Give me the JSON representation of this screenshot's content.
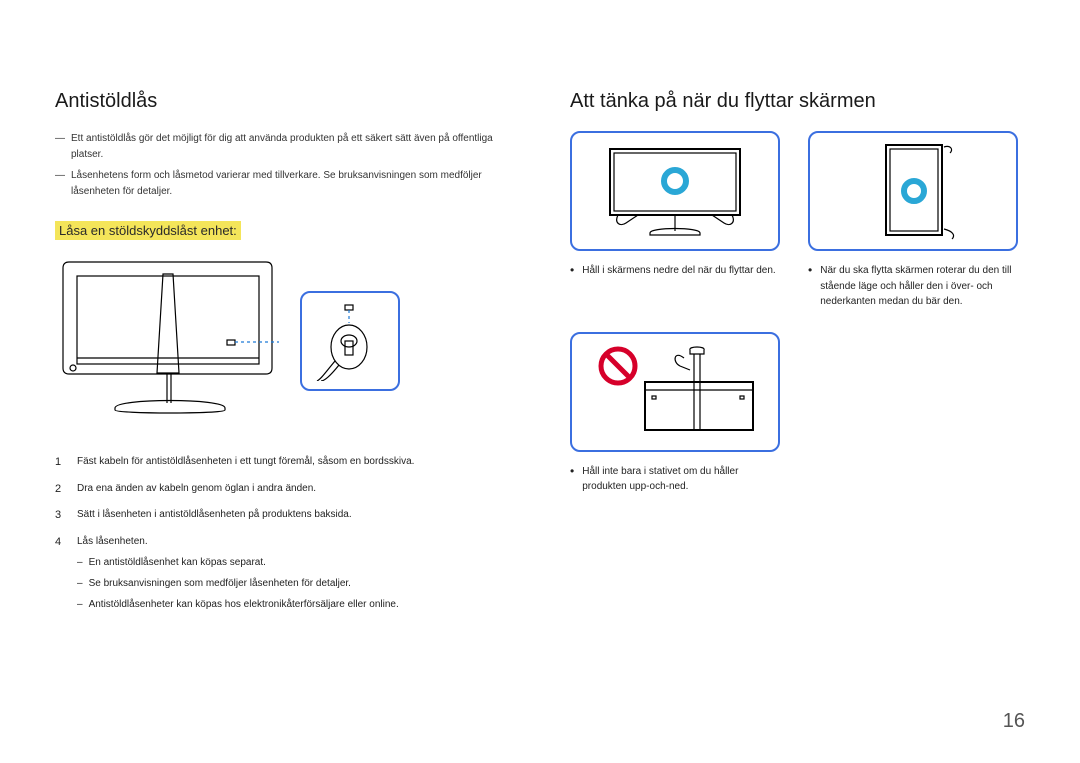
{
  "left": {
    "title": "Antistöldlås",
    "notes": [
      "Ett antistöldlås gör det möjligt för dig att använda produkten på ett säkert sätt även på offentliga platser.",
      "Låsenhetens form och låsmetod varierar med tillverkare. Se bruksanvisningen som medföljer låsenheten för detaljer."
    ],
    "subheading": "Låsa en stöldskyddslåst enhet:",
    "steps": [
      "Fäst kabeln för antistöldlåsenheten i ett tungt föremål, såsom en bordsskiva.",
      "Dra ena änden av kabeln genom öglan i andra änden.",
      "Sätt i låsenheten i antistöldlåsenheten på produktens baksida.",
      "Lås låsenheten."
    ],
    "sub_notes": [
      "En antistöldlåsenhet kan köpas separat.",
      "Se bruksanvisningen som medföljer låsenheten för detaljer.",
      "Antistöldlåsenheter kan köpas hos elektronikåterförsäljare eller online."
    ]
  },
  "right": {
    "title": "Att tänka på när du flyttar skärmen",
    "panel_a_caption": "Håll i skärmens nedre del när du flyttar den.",
    "panel_b_caption": "När du ska flytta skärmen roterar du den till stående läge och håller den i över- och nederkanten medan du bär den.",
    "panel_c_caption": "Håll inte bara i stativet om du håller produkten upp-och-ned."
  },
  "page_number": "16",
  "dash": "―"
}
